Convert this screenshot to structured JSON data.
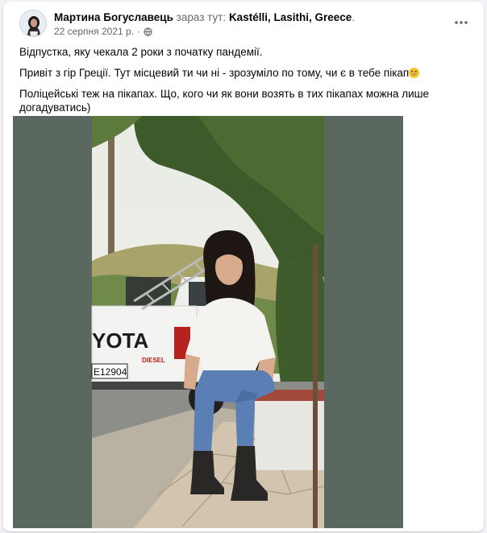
{
  "post": {
    "author_name": "Мартина Богуславець",
    "at_text": "зараз тут:",
    "place": "Kastélli, Lasithi, Greece",
    "place_suffix": ".",
    "date": "22 серпня 2021 р.",
    "date_sep": "·",
    "privacy_icon": "globe-icon",
    "more_icon": "more-options-icon",
    "paragraphs": [
      "Відпустка, яку чекала 2 роки з початку пандемії.",
      "Привіт з гір Греції. Тут місцевий ти чи ні - зрозуміло по тому, чи є в тебе пікап",
      "Поліцейські теж на пікапах. Що, кого чи як вони возять в тих пікапах можна лише догадуватись)"
    ],
    "emoji_icon": "grinning-face-icon"
  },
  "photo": {
    "truck_brand_text": "YOTA",
    "truck_sub_text": "DIESEL",
    "plate_text": "E12904"
  },
  "colors": {
    "text_primary": "#050505",
    "text_secondary": "#65676b",
    "card_bg": "#ffffff",
    "page_bg": "#f0f2f5",
    "photo_border": "#5b6860"
  }
}
